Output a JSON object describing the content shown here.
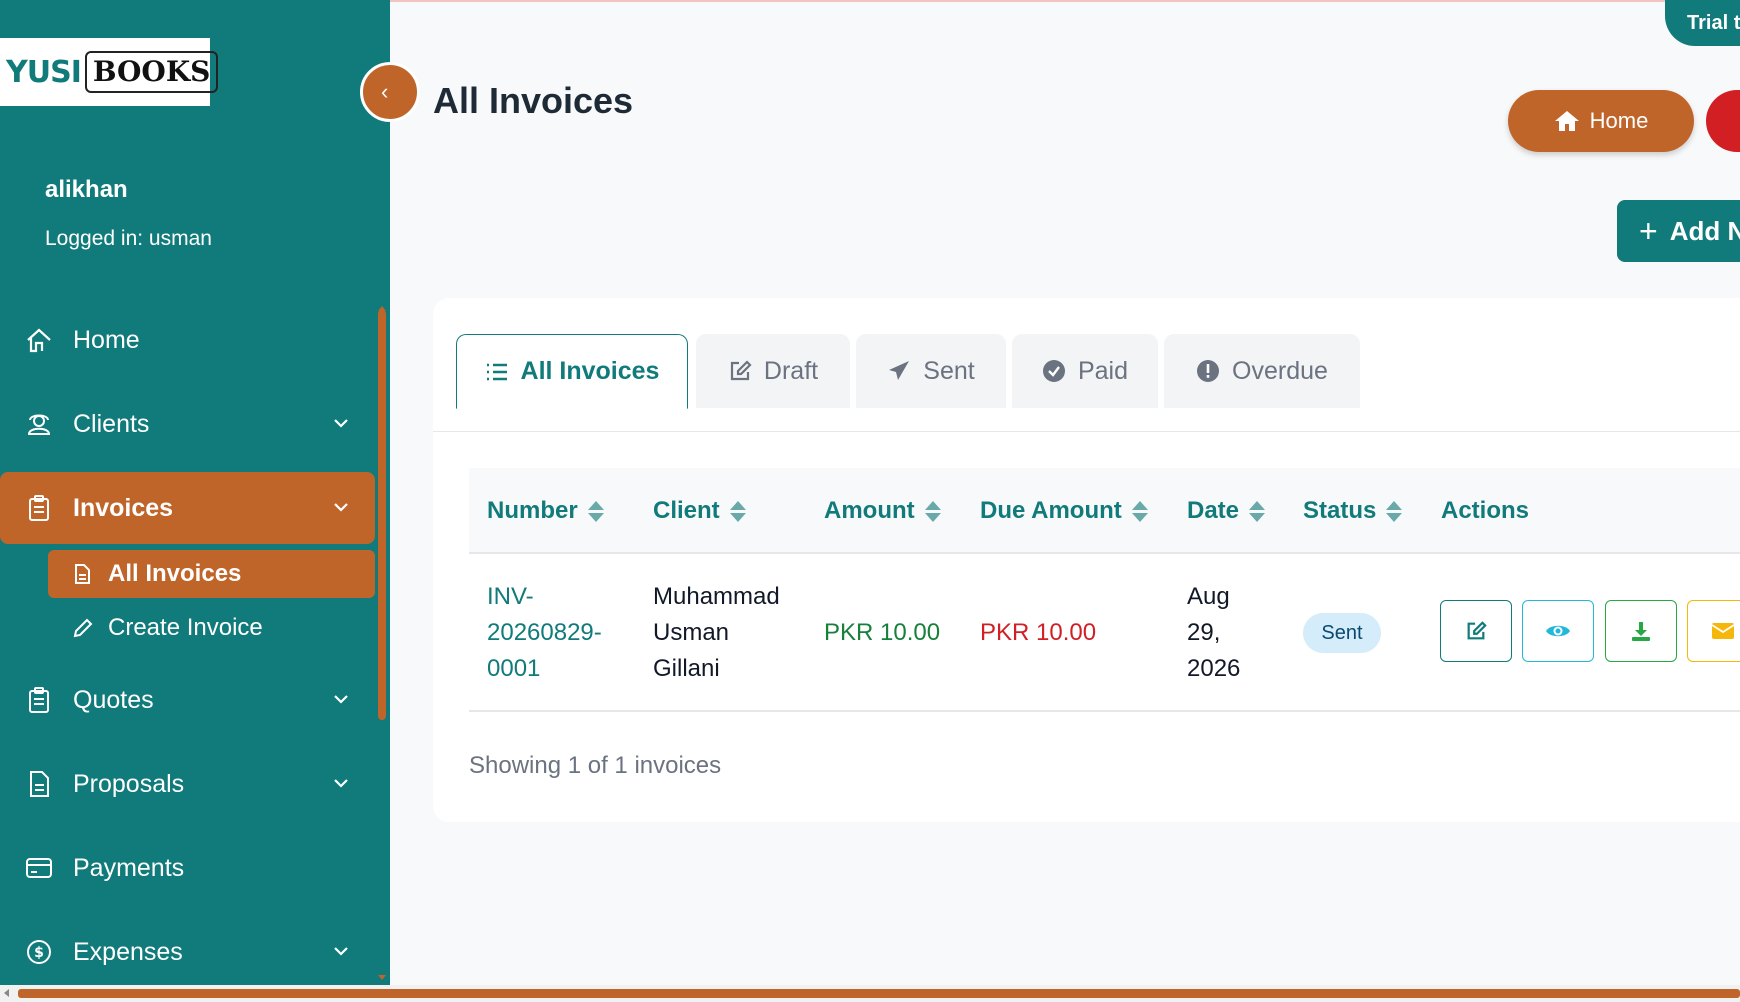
{
  "brand": {
    "logo_left": "YUSI",
    "logo_right": "BOOKS"
  },
  "user": {
    "name": "alikhan",
    "logged_in": "Logged in: usman"
  },
  "sidebar": {
    "items": [
      {
        "label": "Home",
        "icon": "home-icon"
      },
      {
        "label": "Clients",
        "icon": "clients-icon"
      },
      {
        "label": "Invoices",
        "icon": "clipboard-icon"
      },
      {
        "label": "Quotes",
        "icon": "clipboard-icon"
      },
      {
        "label": "Proposals",
        "icon": "document-icon"
      },
      {
        "label": "Payments",
        "icon": "credit-card-icon"
      },
      {
        "label": "Expenses",
        "icon": "dollar-circle-icon"
      }
    ],
    "sub_items": [
      {
        "label": "All Invoices",
        "icon": "file-icon"
      },
      {
        "label": "Create Invoice",
        "icon": "pencil-icon"
      }
    ]
  },
  "header": {
    "title": "All Invoices",
    "trial_label": "Trial t",
    "home_button": "Home",
    "add_button": "Add N"
  },
  "tabs": [
    {
      "label": "All Invoices",
      "icon": "list-icon"
    },
    {
      "label": "Draft",
      "icon": "edit-icon"
    },
    {
      "label": "Sent",
      "icon": "paper-plane-icon"
    },
    {
      "label": "Paid",
      "icon": "check-circle-icon"
    },
    {
      "label": "Overdue",
      "icon": "exclamation-circle-icon"
    }
  ],
  "table": {
    "columns": [
      "Number",
      "Client",
      "Amount",
      "Due Amount",
      "Date",
      "Status",
      "Actions"
    ],
    "rows": [
      {
        "number_lines": [
          "INV-",
          "20260829-",
          "0001"
        ],
        "client_lines": [
          "Muhammad",
          "Usman",
          "Gillani"
        ],
        "amount": "PKR 10.00",
        "due_amount": "PKR 10.00",
        "date_lines": [
          "Aug",
          "29,",
          "2026"
        ],
        "status": "Sent"
      }
    ],
    "footer": "Showing 1 of 1 invoices"
  },
  "colors": {
    "primary": "#117a7a",
    "accent": "#c0652a",
    "danger": "#d11f24",
    "success": "#16803c"
  }
}
